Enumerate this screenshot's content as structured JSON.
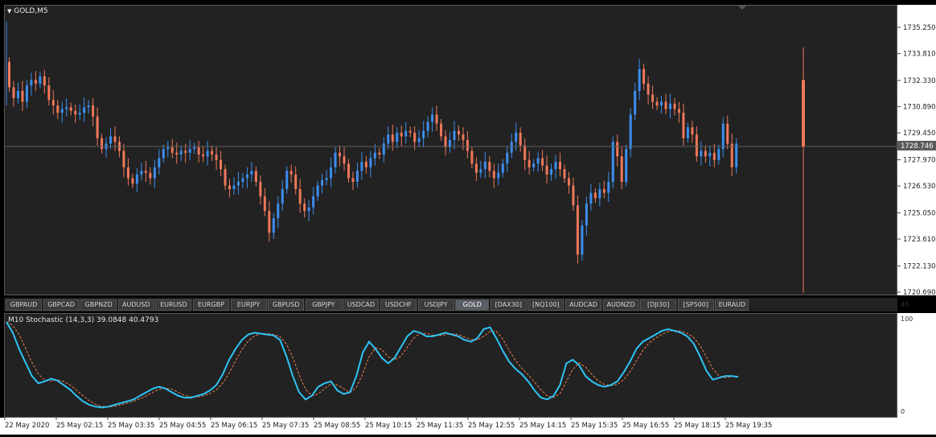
{
  "chart": {
    "symbol_title": "GOLD,M5",
    "current_price_label": "1728.746",
    "price_ticks": [
      "1735.250",
      "1733.810",
      "1732.330",
      "1730.890",
      "1729.450",
      "1727.970",
      "1726.530",
      "1725.050",
      "1723.610",
      "1722.130",
      "1720.690"
    ],
    "colors": {
      "bull": "#3c8ef0",
      "bear": "#f0785a",
      "background": "#222222",
      "stoch_main": "#2ec4f5",
      "stoch_signal": "#f08050"
    }
  },
  "tabs": [
    "GBPAUD",
    "GBPCAD",
    "GBPNZD",
    "AUDUSD",
    "EURUSD",
    "EURGBP",
    "EURJPY",
    "GBPUSD",
    "GBPJPY",
    "USDCAD",
    "USDCHF",
    "USDJPY",
    "GOLD",
    "[DAX30]",
    "[NQ100]",
    "AUDCAD",
    "AUDNZD",
    "[DJI30]",
    "[SP500]",
    "EURAUD"
  ],
  "active_tab": "GOLD",
  "indicator": {
    "title": "M10 Stochastic (14,3,3) 39.0848 40.4793",
    "scale_top": "100",
    "scale_bottom": "0",
    "scale_corner": "40"
  },
  "time_labels": [
    "22 May 2020",
    "25 May 02:15",
    "25 May 03:35",
    "25 May 04:55",
    "25 May 06:15",
    "25 May 07:35",
    "25 May 08:55",
    "25 May 10:15",
    "25 May 11:35",
    "25 May 12:55",
    "25 May 14:15",
    "25 May 15:35",
    "25 May 16:55",
    "25 May 18:15",
    "25 May 19:35"
  ],
  "chart_data": {
    "type": "candlestick",
    "closes": [
      1732.0,
      1731.4,
      1731.8,
      1731.2,
      1732.1,
      1732.4,
      1732.2,
      1732.6,
      1732.1,
      1731.3,
      1731.0,
      1730.6,
      1730.8,
      1730.9,
      1730.7,
      1730.5,
      1730.6,
      1730.9,
      1731.0,
      1730.4,
      1729.2,
      1728.6,
      1728.9,
      1729.3,
      1729.0,
      1728.5,
      1727.6,
      1727.0,
      1726.7,
      1727.2,
      1727.4,
      1727.3,
      1727.0,
      1727.6,
      1728.1,
      1728.6,
      1728.7,
      1728.4,
      1728.3,
      1728.5,
      1728.4,
      1728.6,
      1728.7,
      1728.3,
      1728.2,
      1728.5,
      1728.3,
      1728.0,
      1727.5,
      1726.6,
      1726.4,
      1726.6,
      1726.8,
      1727.0,
      1727.2,
      1727.4,
      1726.8,
      1726.0,
      1725.2,
      1724.0,
      1724.8,
      1725.6,
      1726.4,
      1727.4,
      1727.2,
      1726.4,
      1725.6,
      1725.2,
      1725.4,
      1726.0,
      1726.6,
      1726.9,
      1727.0,
      1727.6,
      1728.4,
      1728.2,
      1727.8,
      1727.0,
      1726.8,
      1727.4,
      1727.9,
      1727.6,
      1728.1,
      1728.4,
      1728.3,
      1728.9,
      1729.4,
      1729.0,
      1729.5,
      1729.3,
      1729.6,
      1729.5,
      1729.0,
      1729.2,
      1729.6,
      1730.1,
      1730.5,
      1730.0,
      1729.3,
      1728.7,
      1729.1,
      1729.6,
      1729.4,
      1729.1,
      1728.5,
      1727.8,
      1727.3,
      1727.5,
      1727.9,
      1727.4,
      1727.0,
      1727.3,
      1727.8,
      1728.4,
      1729.0,
      1729.5,
      1728.8,
      1728.0,
      1727.6,
      1727.8,
      1728.1,
      1727.7,
      1727.2,
      1727.5,
      1727.9,
      1727.5,
      1727.0,
      1726.6,
      1725.5,
      1722.8,
      1724.4,
      1725.6,
      1726.2,
      1725.9,
      1726.4,
      1726.2,
      1726.8,
      1729.0,
      1728.2,
      1726.8,
      1728.6,
      1730.5,
      1731.8,
      1733.0,
      1732.2,
      1731.6,
      1731.2,
      1731.0,
      1731.2,
      1730.8,
      1731.1,
      1730.8,
      1730.6,
      1729.2,
      1729.8,
      1729.4,
      1728.2,
      1728.5,
      1728.2,
      1728.4,
      1728.0,
      1728.6,
      1730.0,
      1728.9,
      1727.6,
      1728.9
    ],
    "range": [
      1720.69,
      1735.25
    ],
    "stochastic": {
      "main": 39.0848,
      "signal": 40.4793,
      "range": [
        0,
        100
      ]
    }
  }
}
